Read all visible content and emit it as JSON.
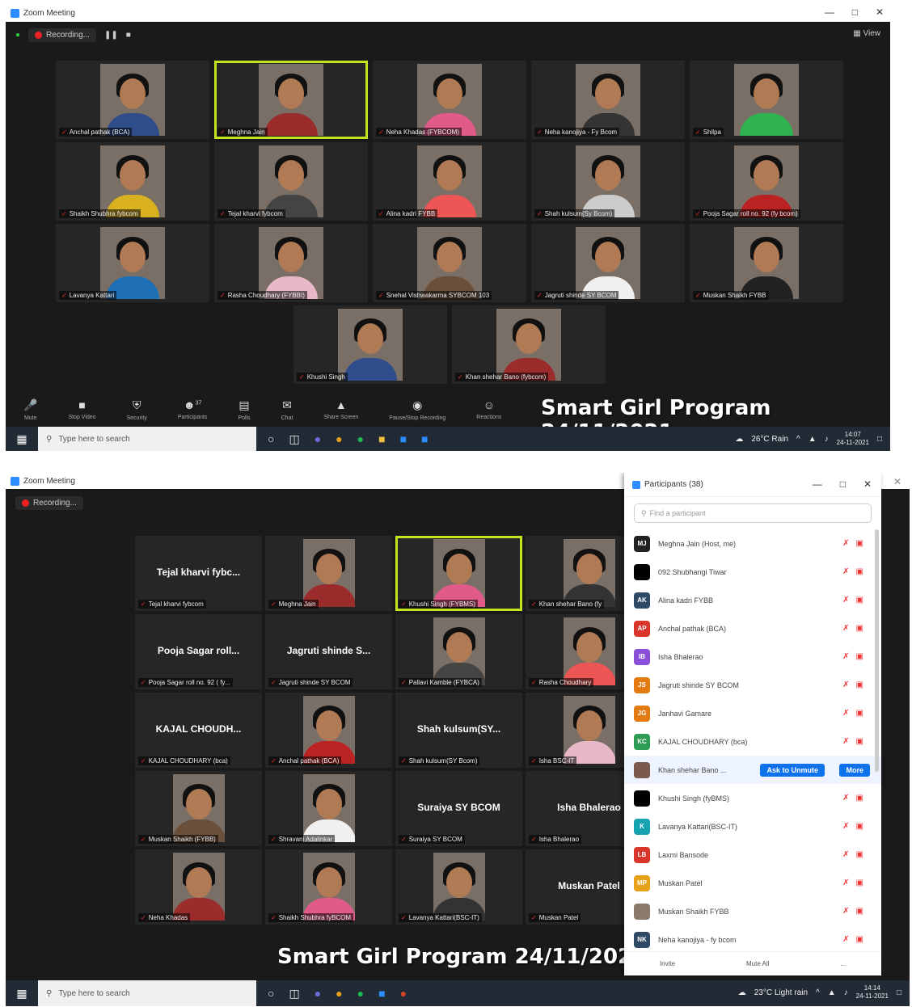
{
  "app_title": "Zoom Meeting",
  "recording_label": "Recording...",
  "view_label": "View",
  "overlay_text": "Smart Girl Program 24/11/2021",
  "toolbar": [
    {
      "label": "Mute",
      "icon": "microphone-icon"
    },
    {
      "label": "Stop Video",
      "icon": "video-camera-icon"
    },
    {
      "label": "Security",
      "icon": "shield-icon"
    },
    {
      "label": "Participants",
      "icon": "participants-icon",
      "count": "37"
    },
    {
      "label": "Polls",
      "icon": "polls-icon"
    },
    {
      "label": "Chat",
      "icon": "chat-icon"
    },
    {
      "label": "Share Screen",
      "icon": "share-screen-icon"
    },
    {
      "label": "Pause/Stop Recording",
      "icon": "record-icon"
    },
    {
      "label": "Reactions",
      "icon": "reactions-icon"
    }
  ],
  "shot1": {
    "tiles": [
      {
        "name": "Anchal pathak (BCA)"
      },
      {
        "name": "Meghna Jain",
        "active": true
      },
      {
        "name": "Neha Khadas (FYBCOM)"
      },
      {
        "name": "Neha kanojiya - Fy Bcom"
      },
      {
        "name": "Shilpa"
      },
      {
        "name": "Shaikh Shubhra fybcom"
      },
      {
        "name": "Tejal kharvi fybcom"
      },
      {
        "name": "Alina kadri FYBB"
      },
      {
        "name": "Shah kulsum(Sy Bcom)"
      },
      {
        "name": "Pooja Sagar roll no. 92 (fy bcom)"
      },
      {
        "name": "Lavanya Kattari"
      },
      {
        "name": "Rasha Choudhary (FYBBI)"
      },
      {
        "name": "Snehal Vishwakarma SYBCOM 103"
      },
      {
        "name": "Jagruti shinde SY BCOM"
      },
      {
        "name": "Muskan Shaikh FYBB"
      },
      {
        "name": "Khushi Singh"
      },
      {
        "name": "Khan shehar Bano (fybcom)"
      }
    ],
    "taskbar": {
      "search_placeholder": "Type here to search",
      "weather": "26°C Rain",
      "time": "14:07",
      "date": "24-11-2021"
    }
  },
  "shot2": {
    "tiles": [
      {
        "name": "Tejal kharvi fybcom",
        "big": "Tejal kharvi fybc..."
      },
      {
        "name": "Meghna Jain"
      },
      {
        "name": "Khushi Singh (FYBMS)",
        "active": true
      },
      {
        "name": "Khan shehar Bano (fy"
      },
      {
        "name": "Pooja Sagar roll no. 92 ( fy...",
        "big": "Pooja Sagar roll..."
      },
      {
        "name": "Jagruti shinde SY BCOM",
        "big": "Jagruti shinde S..."
      },
      {
        "name": "Pallavi Kamble (FYBCA)"
      },
      {
        "name": "Rasha Choudhary"
      },
      {
        "name": "KAJAL CHOUDHARY (bca)",
        "big": "KAJAL CHOUDH..."
      },
      {
        "name": "Anchal pathak (BCA)"
      },
      {
        "name": "Shah kulsum(SY Bcom)",
        "big": "Shah kulsum(SY..."
      },
      {
        "name": "Isha BSC-IT"
      },
      {
        "name": "Muskan Shaikh (FYBB)"
      },
      {
        "name": "Shravani Adalinkar"
      },
      {
        "name": "Suraiya SY BCOM",
        "big": "Suraiya SY BCOM"
      },
      {
        "name": "Isha Bhalerao",
        "big": "Isha Bhalerao"
      },
      {
        "name": "Neha Khadas"
      },
      {
        "name": "Shaikh Shubhra fyBCOM"
      },
      {
        "name": "Lavanya Kattari(BSC-IT)"
      },
      {
        "name": "Muskan Patel",
        "big": "Muskan Patel"
      }
    ],
    "participants_panel": {
      "title": "Participants (38)",
      "search_placeholder": "Find a participant",
      "rows": [
        {
          "initials": "MJ",
          "name": "Meghna Jain (Host, me)",
          "color": "#222222"
        },
        {
          "initials": "",
          "name": "092 Shubhangi Tiwar",
          "color": "#000000"
        },
        {
          "initials": "AK",
          "name": "Alina kadri FYBB",
          "color": "#2f4a66"
        },
        {
          "initials": "AP",
          "name": "Anchal pathak (BCA)",
          "color": "#d9352a"
        },
        {
          "initials": "IB",
          "name": "Isha Bhalerao",
          "color": "#8a4fd8"
        },
        {
          "initials": "JS",
          "name": "Jagruti shinde SY BCOM",
          "color": "#e37a12"
        },
        {
          "initials": "JG",
          "name": "Janhavi Gamare",
          "color": "#e37a12"
        },
        {
          "initials": "KC",
          "name": "KAJAL CHOUDHARY (bca)",
          "color": "#2e9c52"
        },
        {
          "initials": "",
          "name": "Khan shehar Bano ...",
          "color": "#7a5a4a",
          "ask": "Ask to Unmute",
          "more": "More"
        },
        {
          "initials": "",
          "name": "Khushi Singh (fyBMS)",
          "color": "#000000"
        },
        {
          "initials": "K",
          "name": "Lavanya Kattari(BSC-IT)",
          "color": "#17a2b0"
        },
        {
          "initials": "LB",
          "name": "Laxmi Bansode",
          "color": "#d9352a"
        },
        {
          "initials": "MP",
          "name": "Muskan Patel",
          "color": "#e8a21a"
        },
        {
          "initials": "",
          "name": "Muskan Shaikh FYBB",
          "color": "#8a7a6a"
        },
        {
          "initials": "NK",
          "name": "Neha kanojiya - fy bcom",
          "color": "#2f4a66"
        }
      ],
      "invite_label": "Invite",
      "mute_all_label": "Mute All",
      "more_label": "..."
    },
    "taskbar": {
      "search_placeholder": "Type here to search",
      "weather": "23°C Light rain",
      "time": "14:14",
      "date": "24-11-2021"
    }
  }
}
